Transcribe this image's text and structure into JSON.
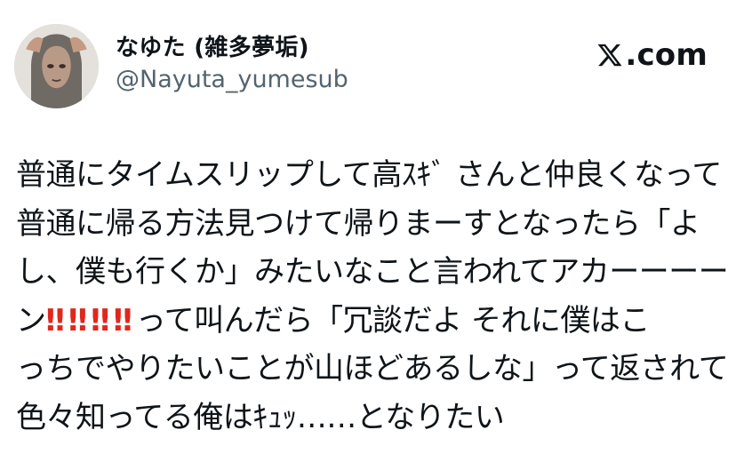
{
  "author": {
    "display_name": "なゆた (雑多夢垢)",
    "handle": "@Nayuta_yumesub"
  },
  "source": {
    "logo_text": ".com",
    "icon": "x-logo-icon"
  },
  "tweet": {
    "lines": [
      "普通にタイムスリップして高ｽｷﾞ さんと仲良くなって",
      "普通に帰る方法見つけて帰りまーすとなったら「よ",
      "し、僕も行くか」みたいなこと言われてアカーーーー",
      "ン",
      "って叫んだら「冗談だよ それに僕はこ",
      "っちでやりたいことが山ほどあるしな」って返されて",
      "色々知ってる俺はｷｭｯ……となりたい"
    ],
    "emphasis_mark": "‼",
    "colors": {
      "emphasis": "#e0271d",
      "text": "#0f1419",
      "handle": "#536471"
    }
  }
}
